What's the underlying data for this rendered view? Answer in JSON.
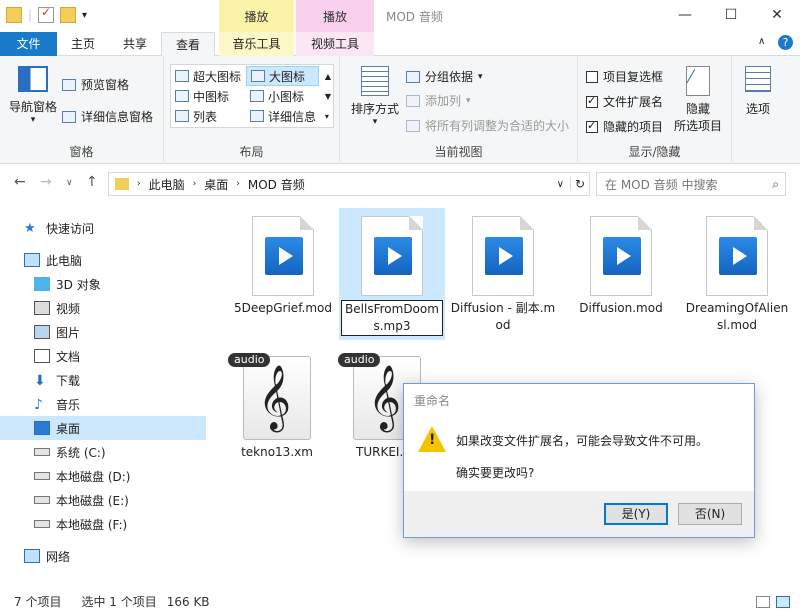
{
  "window": {
    "title": "MOD 音频",
    "context_tab_play_1": "播放",
    "context_tab_play_2": "播放",
    "minimize": "—",
    "maximize": "☐",
    "close": "✕"
  },
  "ribbon_tabs": {
    "file": "文件",
    "home": "主页",
    "share": "共享",
    "view": "查看",
    "music_tools": "音乐工具",
    "video_tools": "视频工具"
  },
  "ribbon": {
    "pane": {
      "nav_pane": "导航窗格",
      "preview_pane": "预览窗格",
      "details_pane": "详细信息窗格",
      "label": "窗格"
    },
    "layout": {
      "extra_large": "超大图标",
      "large": "大图标",
      "medium": "中图标",
      "small": "小图标",
      "list": "列表",
      "details": "详细信息",
      "label": "布局"
    },
    "current_view": {
      "sort_by": "排序方式",
      "group_by": "分组依据",
      "add_columns": "添加列",
      "size_columns": "将所有列调整为合适的大小",
      "label": "当前视图"
    },
    "show_hide": {
      "item_checkboxes": "项目复选框",
      "file_extensions": "文件扩展名",
      "hidden_items": "隐藏的项目",
      "hide_selected_1": "隐藏",
      "hide_selected_2": "所选项目",
      "label": "显示/隐藏"
    },
    "options": "选项"
  },
  "address": {
    "crumbs": [
      "此电脑",
      "桌面",
      "MOD 音频"
    ],
    "search_placeholder": "在 MOD 音频 中搜索"
  },
  "nav": {
    "quick_access": "快速访问",
    "this_pc": "此电脑",
    "objects3d": "3D 对象",
    "videos": "视频",
    "pictures": "图片",
    "documents": "文档",
    "downloads": "下载",
    "music": "音乐",
    "desktop": "桌面",
    "system_c": "系统 (C:)",
    "disk_d": "本地磁盘 (D:)",
    "disk_e": "本地磁盘 (E:)",
    "disk_f": "本地磁盘 (F:)",
    "network": "网络"
  },
  "files": [
    {
      "name": "5DeepGrief.mod"
    },
    {
      "name": "BellsFromDooms.mp3"
    },
    {
      "name": "Diffusion - 副本.mod"
    },
    {
      "name": "Diffusion.mod"
    },
    {
      "name": "DreamingOfAliensl.mod"
    },
    {
      "name": "tekno13.xm",
      "badge": "audio"
    },
    {
      "name": "TURKEI.",
      "badge": "audio"
    }
  ],
  "status": {
    "count": "7 个项目",
    "selection": "选中 1 个项目",
    "size": "166 KB"
  },
  "dialog": {
    "title": "重命名",
    "message": "如果改变文件扩展名，可能会导致文件不可用。",
    "confirm": "确实要更改吗?",
    "yes": "是(Y)",
    "no": "否(N)"
  }
}
